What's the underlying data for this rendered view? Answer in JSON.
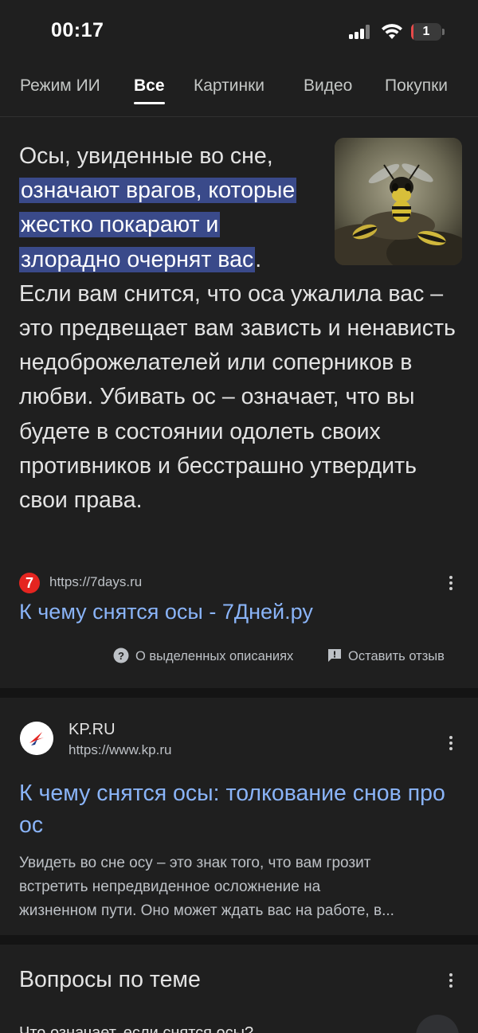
{
  "status_bar": {
    "time": "00:17",
    "battery": "1",
    "battery_level": 0.01,
    "icons": [
      "signal-icon",
      "wifi-icon",
      "battery-icon"
    ]
  },
  "tabs": [
    {
      "label": "Режим ИИ",
      "active": false
    },
    {
      "label": "Все",
      "active": true
    },
    {
      "label": "Картинки",
      "active": false
    },
    {
      "label": "Видео",
      "active": false
    },
    {
      "label": "Покупки",
      "active": false
    }
  ],
  "featured_snippet": {
    "text_before": "Осы, увиденные во сне, ",
    "highlight": "означают врагов, которые жестко покарают и злорадно очернят вас",
    "text_after": ". Если вам снится, что оса ужалила вас – это предвещает вам зависть и ненависть недоброжелателей или соперников в любви. Убивать ос – означает, что вы будете в состоянии одолеть своих противников и бесстрашно утвердить свои права.",
    "source_favicon": "7",
    "source_url": "https://7days.ru",
    "link_title": "К чему снятся осы - 7Дней.ру",
    "feedback_about": "О выделенных описаниях",
    "feedback_leave": "Оставить отзыв",
    "colors": {
      "highlight": "#3a4a8a",
      "link": "#8ab4f8"
    }
  },
  "result": {
    "site_name": "KP.RU",
    "site_url": "https://www.kp.ru",
    "title": "К чему снятся осы: толкование снов про ос",
    "snippet_lines": [
      "Увидеть во сне осу – это знак того, что вам грозит",
      "встретить непредвиденное осложнение на",
      "жизненном пути. Оно может ждать вас на работе, в..."
    ]
  },
  "related": {
    "title": "Вопросы по теме",
    "first_question": "Что означает, если снятся осы?"
  }
}
